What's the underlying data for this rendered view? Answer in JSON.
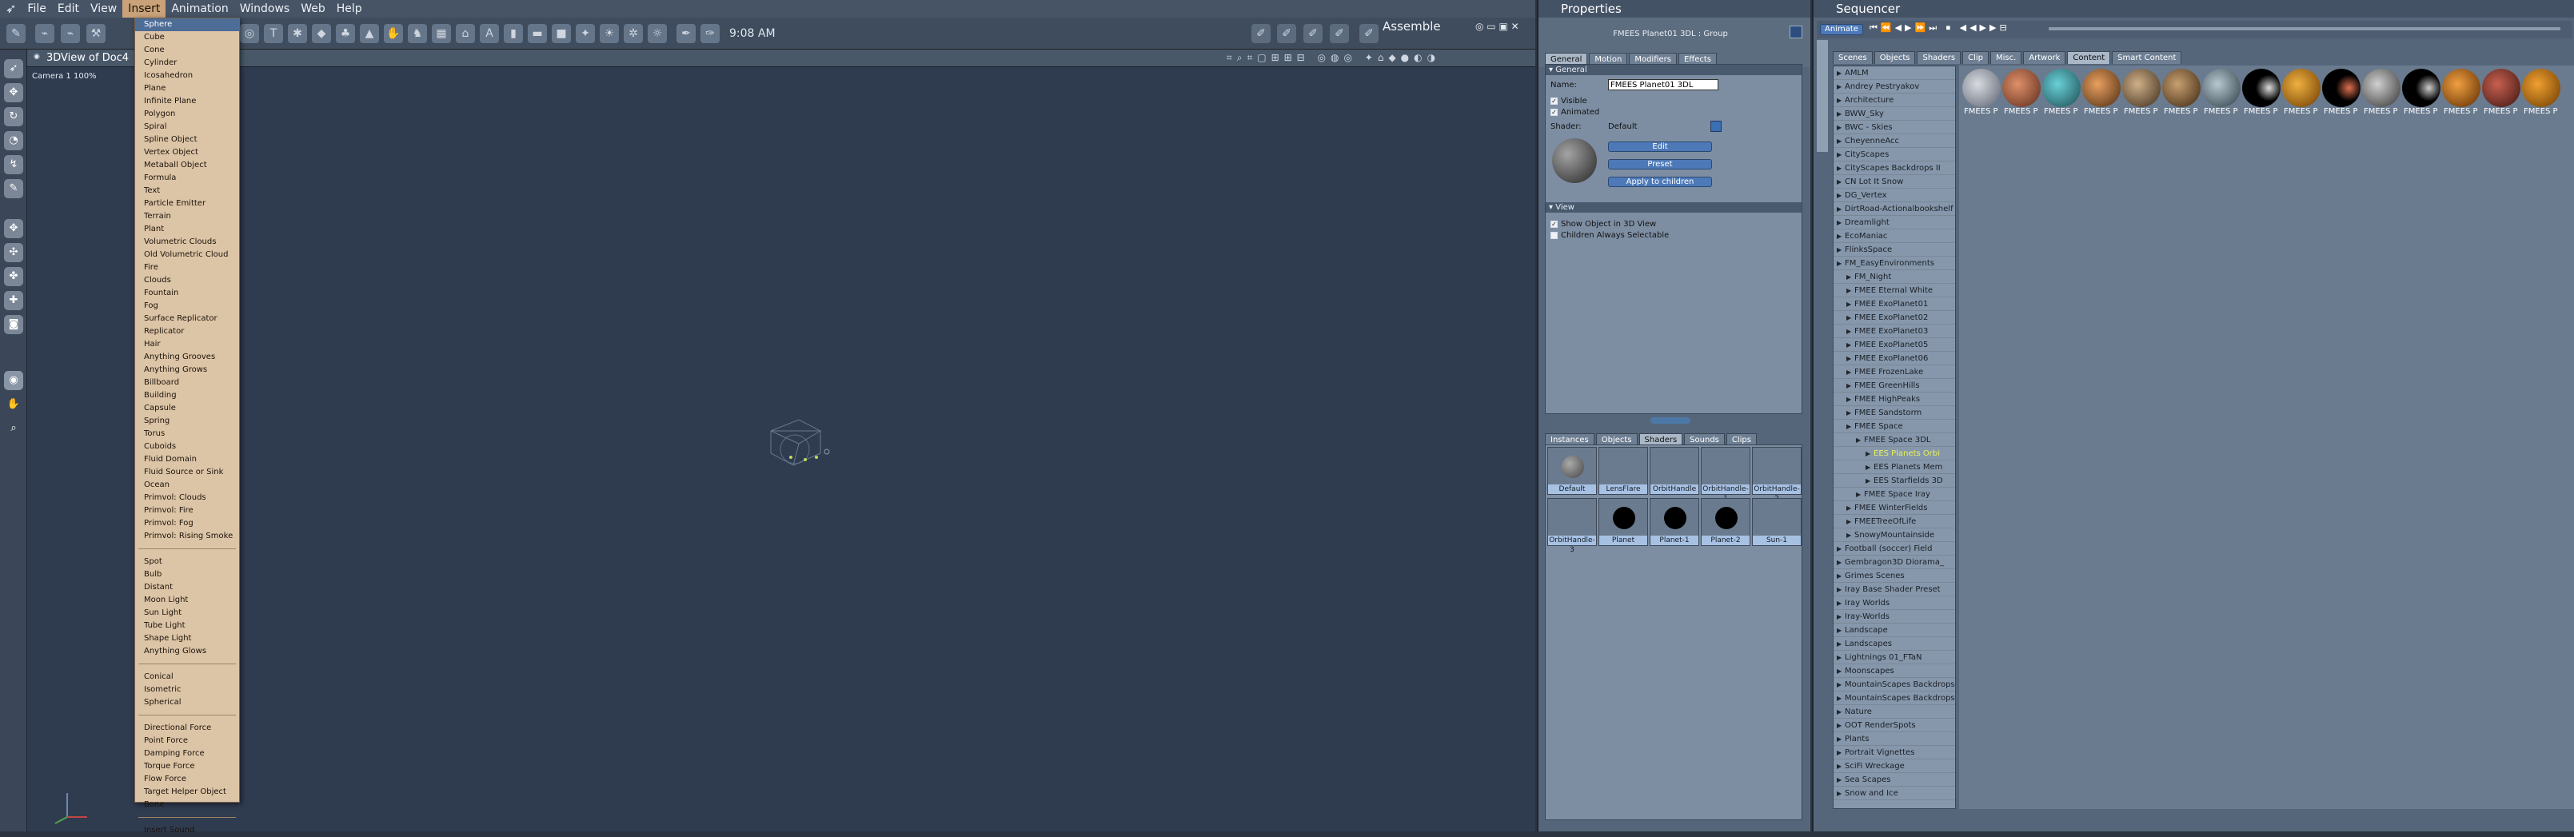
{
  "menubar": {
    "items": [
      "File",
      "Edit",
      "View",
      "Insert",
      "Animation",
      "Windows",
      "Web",
      "Help"
    ],
    "clock": "9:08 AM",
    "room": "Assemble"
  },
  "viewport": {
    "title": "3DView of Doc4",
    "camera": "Camera 1 100%"
  },
  "insert_menu": {
    "groups": [
      [
        "Sphere",
        "Cube",
        "Cone",
        "Cylinder",
        "Icosahedron",
        "Plane",
        "Infinite Plane",
        "Polygon",
        "Spiral",
        "Spline Object",
        "Vertex Object",
        "Metaball Object",
        "Formula",
        "Text",
        "Particle Emitter",
        "Terrain",
        "Plant",
        "Volumetric Clouds",
        "Old Volumetric Cloud",
        "Fire",
        "Clouds",
        "Fountain",
        "Fog",
        "Surface Replicator",
        "Replicator",
        "Hair",
        "Anything Grooves",
        "Anything Grows",
        "Billboard",
        "Building",
        "Capsule",
        "Spring",
        "Torus",
        "Cuboids",
        "Fluid Domain",
        "Fluid Source or Sink",
        "Ocean",
        "Primvol: Clouds",
        "Primvol: Fire",
        "Primvol: Fog",
        "Primvol: Rising Smoke"
      ],
      [
        "Spot",
        "Bulb",
        "Distant",
        "Moon Light",
        "Sun Light",
        "Tube Light",
        "Shape Light",
        "Anything Glows"
      ],
      [
        "Conical",
        "Isometric",
        "Spherical"
      ],
      [
        "Directional Force",
        "Point Force",
        "Damping Force",
        "Torque Force",
        "Flow Force",
        "Target Helper Object",
        "Bone"
      ],
      [
        "Insert Sound"
      ]
    ]
  },
  "properties": {
    "title": "Properties",
    "object": "FMEES Planet01 3DL : Group",
    "tabs": [
      "General",
      "Motion",
      "Modifiers",
      "Effects"
    ],
    "general_label": "General",
    "name_label": "Name:",
    "name_value": "FMEES Planet01 3DL",
    "visible_label": "Visible",
    "animated_label": "Animated",
    "shader_label": "Shader:",
    "shader_value": "Default",
    "edit_btn": "Edit",
    "preset_btn": "Preset",
    "apply_btn": "Apply to children",
    "view_label": "View",
    "show3d_label": "Show Object in 3D View",
    "children_sel_label": "Children Always Selectable",
    "bottom_tabs": [
      "Instances",
      "Objects",
      "Shaders",
      "Sounds",
      "Clips"
    ],
    "shaders": [
      "Default",
      "LensFlare",
      "OrbitHandle",
      "OrbitHandle-1",
      "OrbitHandle-2",
      "OrbitHandle-3",
      "Planet",
      "Planet-1",
      "Planet-2",
      "Sun-1"
    ]
  },
  "sequencer": {
    "title": "Sequencer",
    "animate_btn": "Animate",
    "tabs": [
      "Scenes",
      "Objects",
      "Shaders",
      "Clip",
      "Misc.",
      "Artwork",
      "Content",
      "Smart Content"
    ],
    "tree": [
      "AMLM",
      "Andrey Pestryakov",
      "Architecture",
      "BWW_Sky",
      "BWC - Skies",
      "CheyenneAcc",
      "CityScapes",
      "CityScapes Backdrops II",
      "CN Lot It Snow",
      "DG_Vertex",
      "DirtRoad-Actionalbookshelf",
      "Dreamlight",
      "EcoManiac",
      "FlinksSpace",
      "FM_EasyEnvironments",
      "FM_Night",
      "FMEE Eternal White",
      "FMEE ExoPlanet01",
      "FMEE ExoPlanet02",
      "FMEE ExoPlanet03",
      "FMEE ExoPlanet05",
      "FMEE ExoPlanet06",
      "FMEE FrozenLake",
      "FMEE GreenHills",
      "FMEE HighPeaks",
      "FMEE Sandstorm",
      "FMEE Space",
      "FMEE Space 3DL",
      "EES Planets Orbi",
      "EES Planets Mem",
      "EES Starfields 3D",
      "FMEE Space Iray",
      "FMEE WinterFields",
      "FMEETreeOfLife",
      "SnowyMountainside",
      "Football (soccer) Field",
      "Gembragon3D Diorama_",
      "Grimes Scenes",
      "Iray Base Shader Preset",
      "Iray Worlds",
      "Iray-Worlds",
      "Landscape",
      "Landscapes",
      "Lightnings 01_FTaN",
      "Moonscapes",
      "MountainScapes Backdrops",
      "MountainScapes Backdrops",
      "Nature",
      "OOT RenderSpots",
      "Plants",
      "Portrait Vignettes",
      "SciFi Wreckage",
      "Sea Scapes",
      "Snow and Ice"
    ],
    "thumbs": [
      "FMEES P",
      "FMEES P",
      "FMEES P",
      "FMEES P",
      "FMEES P",
      "FMEES P",
      "FMEES P",
      "FMEES P",
      "FMEES P",
      "FMEES P",
      "FMEES P",
      "FMEES P",
      "FMEES P",
      "FMEES P",
      "FMEES P"
    ]
  }
}
